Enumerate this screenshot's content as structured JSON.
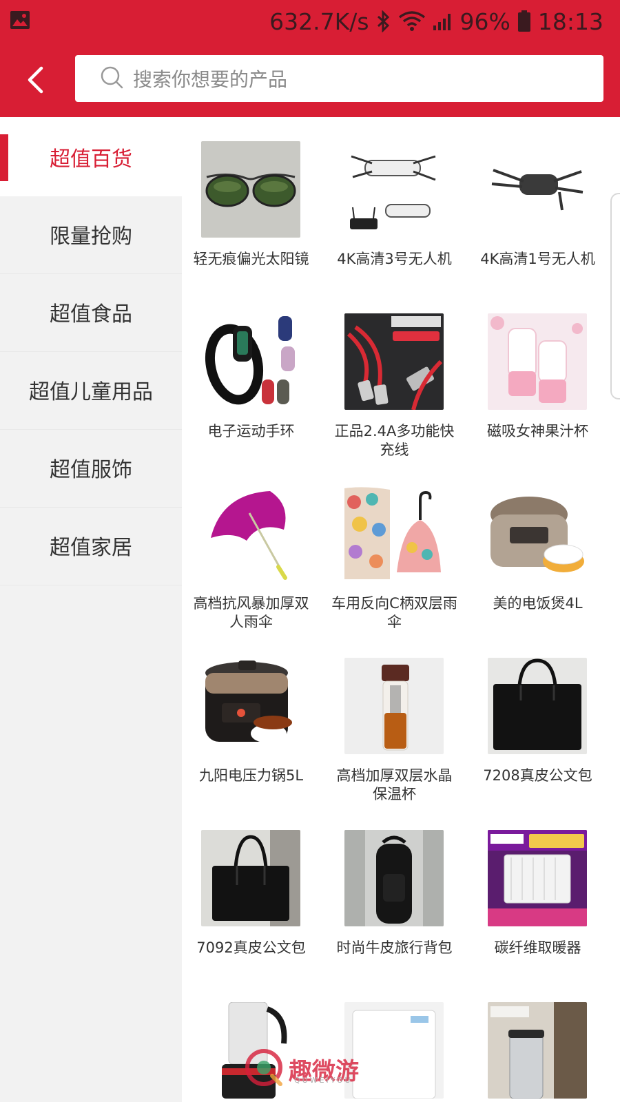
{
  "status_bar": {
    "speed": "632.7K/s",
    "battery": "96%",
    "time": "18:13"
  },
  "search": {
    "placeholder": "搜索你想要的产品"
  },
  "sidebar": {
    "items": [
      {
        "label": "超值百货",
        "active": true
      },
      {
        "label": "限量抢购",
        "active": false
      },
      {
        "label": "超值食品",
        "active": false
      },
      {
        "label": "超值儿童用品",
        "active": false
      },
      {
        "label": "超值服饰",
        "active": false
      },
      {
        "label": "超值家居",
        "active": false
      }
    ]
  },
  "products": [
    {
      "name": "轻无痕偏光太阳镜",
      "icon": "sunglasses-icon"
    },
    {
      "name": "4K高清3号无人机",
      "icon": "drone-icon"
    },
    {
      "name": "4K高清1号无人机",
      "icon": "drone-icon"
    },
    {
      "name": "电子运动手环",
      "icon": "smart-band-icon"
    },
    {
      "name": "正品2.4A多功能快充线",
      "icon": "cable-icon"
    },
    {
      "name": "磁吸女神果汁杯",
      "icon": "juice-cup-icon"
    },
    {
      "name": "高档抗风暴加厚双人雨伞",
      "icon": "umbrella-icon"
    },
    {
      "name": "车用反向C柄双层雨伞",
      "icon": "umbrella-icon"
    },
    {
      "name": "美的电饭煲4L",
      "icon": "rice-cooker-icon"
    },
    {
      "name": "九阳电压力锅5L",
      "icon": "pressure-cooker-icon"
    },
    {
      "name": "高档加厚双层水晶保温杯",
      "icon": "tea-bottle-icon"
    },
    {
      "name": "7208真皮公文包",
      "icon": "briefcase-icon"
    },
    {
      "name": "7092真皮公文包",
      "icon": "briefcase-icon"
    },
    {
      "name": "时尚牛皮旅行背包",
      "icon": "backpack-icon"
    },
    {
      "name": "碳纤维取暖器",
      "icon": "heater-icon"
    },
    {
      "name": "",
      "icon": "blender-icon"
    },
    {
      "name": "",
      "icon": "water-purifier-icon"
    },
    {
      "name": "",
      "icon": "trash-bin-icon"
    }
  ],
  "watermark": {
    "text": "趣微游",
    "sub": "QUWEIYOU"
  },
  "colors": {
    "accent": "#d81e34",
    "sidebar_bg": "#f2f2f2"
  }
}
